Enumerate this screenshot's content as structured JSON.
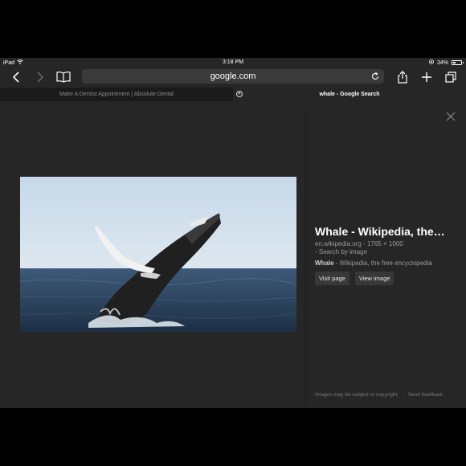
{
  "status": {
    "device": "iPad",
    "time": "3:18 PM",
    "battery": "34%",
    "battery_level": 0.34
  },
  "toolbar": {
    "url": "google.com"
  },
  "tabs": [
    {
      "label": "Make A Dentist Appointment | Absolute Dental"
    },
    {
      "label": "whale - Google Search"
    }
  ],
  "result": {
    "title": "Whale - Wikipedia, the f…",
    "domain": "en.wikipedia.org",
    "dims_sep": "-",
    "dimensions": "1765 × 1000",
    "search_by_image": "- Search by image",
    "desc_bold": "Whale",
    "desc_rest": " - Wikipedia, the free encyclopedia",
    "visit_page": "Visit page",
    "view_image": "View image",
    "footer_copyright": "Images may be subject to copyright.",
    "footer_sep": "-",
    "footer_feedback": "Send feedback"
  },
  "icons": [
    "back-icon",
    "forward-icon",
    "bookmarks-icon",
    "reload-icon",
    "share-icon",
    "new-tab-icon",
    "tabs-icon",
    "wifi-icon",
    "location-icon",
    "close-icon"
  ]
}
